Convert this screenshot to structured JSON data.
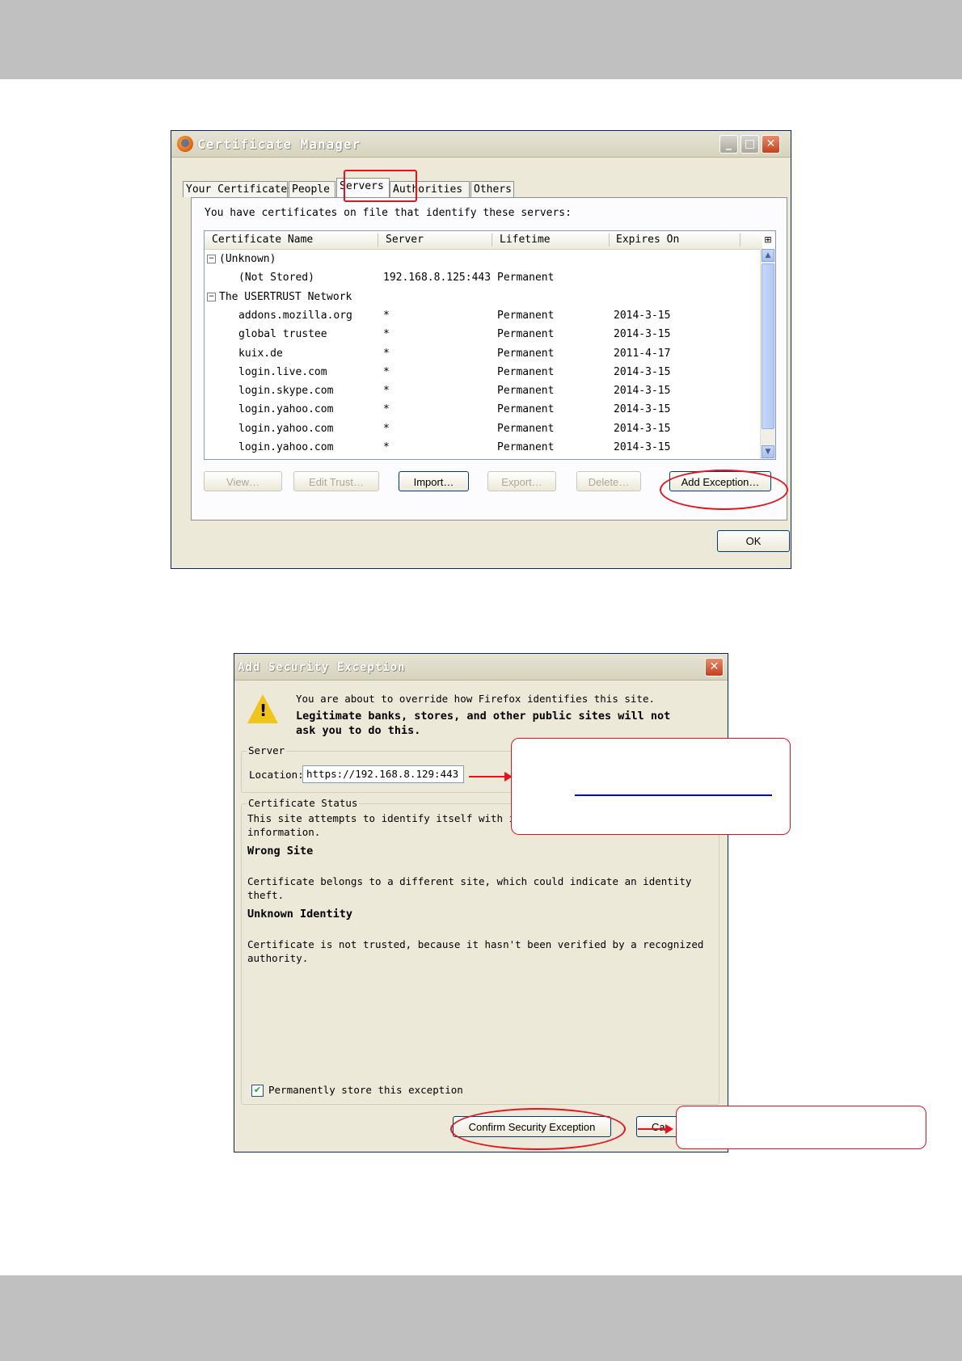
{
  "certificate_manager": {
    "title": "Certificate Manager",
    "tabs": [
      "Your Certificates",
      "People",
      "Servers",
      "Authorities",
      "Others"
    ],
    "active_tab": "Servers",
    "intro": "You have certificates on file that identify these servers:",
    "columns": [
      "Certificate Name",
      "Server",
      "Lifetime",
      "Expires On"
    ],
    "rows": [
      {
        "name": "(Unknown)",
        "server": "",
        "lifetime": "",
        "expires": "",
        "group": true
      },
      {
        "name": "(Not Stored)",
        "server": "192.168.8.125:443",
        "lifetime": "Permanent",
        "expires": ""
      },
      {
        "name": "The USERTRUST Network",
        "server": "",
        "lifetime": "",
        "expires": "",
        "group": true
      },
      {
        "name": "addons.mozilla.org",
        "server": "*",
        "lifetime": "Permanent",
        "expires": "2014-3-15"
      },
      {
        "name": "global trustee",
        "server": "*",
        "lifetime": "Permanent",
        "expires": "2014-3-15"
      },
      {
        "name": "kuix.de",
        "server": "*",
        "lifetime": "Permanent",
        "expires": "2011-4-17"
      },
      {
        "name": "login.live.com",
        "server": "*",
        "lifetime": "Permanent",
        "expires": "2014-3-15"
      },
      {
        "name": "login.skype.com",
        "server": "*",
        "lifetime": "Permanent",
        "expires": "2014-3-15"
      },
      {
        "name": "login.yahoo.com",
        "server": "*",
        "lifetime": "Permanent",
        "expires": "2014-3-15"
      },
      {
        "name": "login.yahoo.com",
        "server": "*",
        "lifetime": "Permanent",
        "expires": "2014-3-15"
      },
      {
        "name": "login.yahoo.com",
        "server": "*",
        "lifetime": "Permanent",
        "expires": "2014-3-15"
      }
    ],
    "buttons": {
      "view": "View…",
      "edit_trust": "Edit Trust…",
      "import": "Import…",
      "export": "Export…",
      "delete": "Delete…",
      "add_exception": "Add Exception…",
      "ok": "OK"
    },
    "window_buttons": {
      "minimize": "_",
      "maximize": "□",
      "close": "✕"
    },
    "icons": {
      "app": "firefox-icon",
      "twisty": "minus-icon",
      "column_picker": "column-picker-icon"
    }
  },
  "security_exception": {
    "title": "Add Security Exception",
    "warning_line1": "You are about to override how Firefox identifies this site.",
    "warning_bold1": "Legitimate banks, stores, and other public sites will not",
    "warning_bold2": "ask you to do this.",
    "server_group": "Server",
    "location_label": "Location:",
    "location_value": "https://192.168.8.129:443",
    "status_group": "Certificate Status",
    "status_line1": "This site attempts to identify itself with i",
    "status_line2": "information.",
    "wrong_site_heading": "Wrong Site",
    "wrong_site_line1": "Certificate belongs to a different site, which could indicate an identity",
    "wrong_site_line2": "theft.",
    "unknown_identity_heading": "Unknown Identity",
    "unknown_line1": "Certificate is not trusted, because it hasn't been verified by a recognized",
    "unknown_line2": "authority.",
    "checkbox_label": "Permanently store this exception",
    "checkbox_checked": true,
    "confirm_button": "Confirm Security Exception",
    "cancel_button_partial": "Ca",
    "close_button": "✕",
    "icons": {
      "warning": "warning-icon"
    }
  },
  "annotation_colors": {
    "highlight": "#e5141c",
    "link_line": "#0000ff"
  }
}
